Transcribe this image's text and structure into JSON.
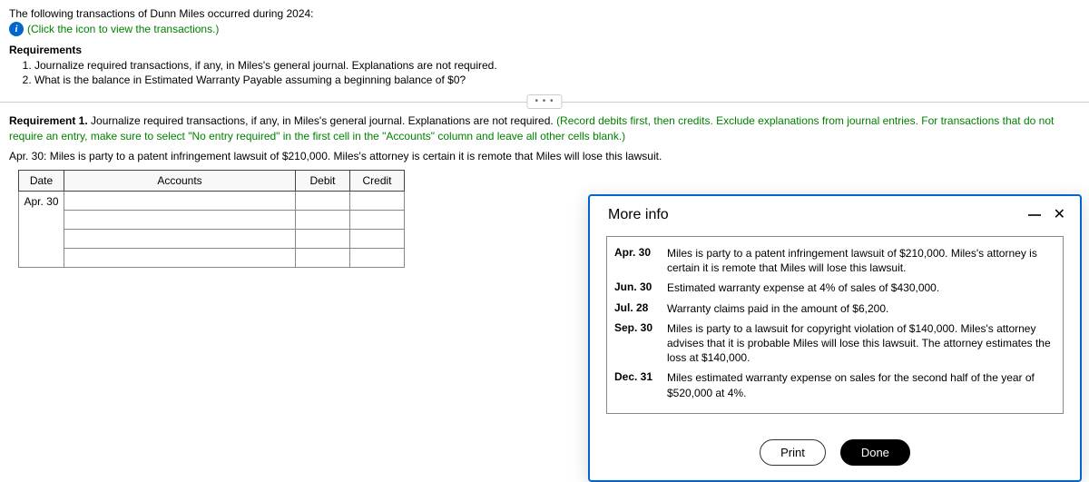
{
  "header": {
    "intro": "The following transactions of Dunn Miles occurred during 2024:",
    "click_hint": "(Click the icon to view the transactions.)",
    "requirements_title": "Requirements",
    "req1": "Journalize required transactions, if any, in Miles's general journal. Explanations are not required.",
    "req2": "What is the balance in Estimated Warranty Payable assuming a beginning balance of $0?"
  },
  "req1": {
    "label": "Requirement 1.",
    "text": " Journalize required transactions, if any, in Miles's general journal. Explanations are not required. ",
    "hint": "(Record debits first, then credits. Exclude explanations from journal entries. For transactions that do not require an entry, make sure to select \"No entry required\" in the first cell in the \"Accounts\" column and leave all other cells blank.)",
    "apr30": "Apr. 30: Miles is party to a patent infringement lawsuit of $210,000. Miles's attorney is certain it is remote that Miles will lose this lawsuit."
  },
  "journal": {
    "cols": {
      "date": "Date",
      "accounts": "Accounts",
      "debit": "Debit",
      "credit": "Credit"
    },
    "date_value": "Apr. 30"
  },
  "modal": {
    "title": "More info",
    "rows": [
      {
        "date": "Apr. 30",
        "text": "Miles is party to a patent infringement lawsuit of $210,000. Miles's attorney is certain it is remote that Miles will lose this lawsuit."
      },
      {
        "date": "Jun. 30",
        "text": "Estimated warranty expense at 4% of sales of $430,000."
      },
      {
        "date": "Jul. 28",
        "text": "Warranty claims paid in the amount of $6,200."
      },
      {
        "date": "Sep. 30",
        "text": "Miles is party to a lawsuit for copyright violation of $140,000. Miles's attorney advises that it is probable Miles will lose this lawsuit. The attorney estimates the loss at $140,000."
      },
      {
        "date": "Dec. 31",
        "text": "Miles estimated warranty expense on sales for the second half of the year of $520,000 at 4%."
      }
    ],
    "print": "Print",
    "done": "Done"
  },
  "ellipsis": "• • •"
}
